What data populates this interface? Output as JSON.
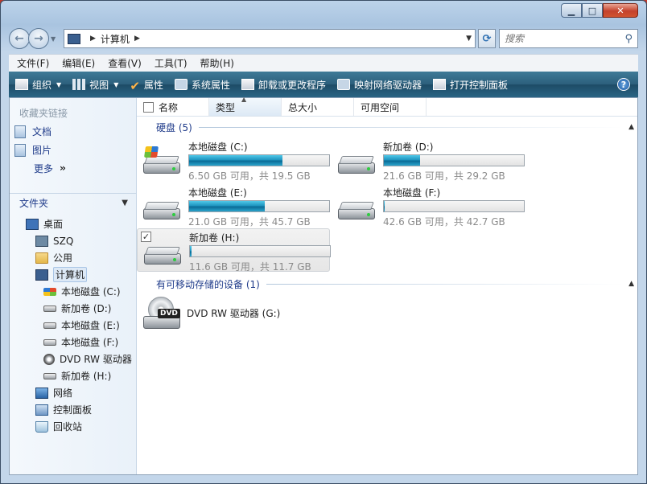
{
  "window": {
    "caption_buttons": {
      "minimize": "▁",
      "maximize": "□",
      "close": "✕"
    }
  },
  "navbar": {
    "back_icon": "back-arrow",
    "forward_icon": "forward-arrow",
    "address_path": "计算机",
    "search_placeholder": "搜索"
  },
  "menubar": {
    "items": [
      "文件(F)",
      "编辑(E)",
      "查看(V)",
      "工具(T)",
      "帮助(H)"
    ]
  },
  "toolbar": {
    "organize": "组织",
    "views": "视图",
    "properties": "属性",
    "system_properties": "系统属性",
    "uninstall": "卸载或更改程序",
    "map_drive": "映射网络驱动器",
    "control_panel": "打开控制面板",
    "help": "?"
  },
  "sidebar": {
    "favorites_title": "收藏夹链接",
    "favorites": [
      "文档",
      "图片"
    ],
    "more": "更多",
    "folders_title": "文件夹",
    "tree": [
      {
        "label": "桌面",
        "icon": "desktop",
        "level": 0
      },
      {
        "label": "SZQ",
        "icon": "user",
        "level": 1
      },
      {
        "label": "公用",
        "icon": "folder",
        "level": 1
      },
      {
        "label": "计算机",
        "icon": "computer",
        "level": 1,
        "selected": true
      },
      {
        "label": "本地磁盘 (C:)",
        "icon": "win-drive",
        "level": 2
      },
      {
        "label": "新加卷 (D:)",
        "icon": "drive",
        "level": 2
      },
      {
        "label": "本地磁盘 (E:)",
        "icon": "drive",
        "level": 2
      },
      {
        "label": "本地磁盘 (F:)",
        "icon": "drive",
        "level": 2
      },
      {
        "label": "DVD RW 驱动器",
        "icon": "dvd",
        "level": 2
      },
      {
        "label": "新加卷 (H:)",
        "icon": "drive",
        "level": 2
      },
      {
        "label": "网络",
        "icon": "network",
        "level": 1
      },
      {
        "label": "控制面板",
        "icon": "cpanel",
        "level": 1
      },
      {
        "label": "回收站",
        "icon": "recycle",
        "level": 1
      }
    ]
  },
  "columns": {
    "name": "名称",
    "type": "类型",
    "total": "总大小",
    "free": "可用空间"
  },
  "groups": {
    "hdd": "硬盘 (5)",
    "removable": "有可移动存储的设备 (1)"
  },
  "drives": [
    {
      "name": "本地磁盘 (C:)",
      "free_text": "6.50 GB 可用，共 19.5 GB",
      "used_fraction": 0.667,
      "system": true
    },
    {
      "name": "新加卷 (D:)",
      "free_text": "21.6 GB 可用，共 29.2 GB",
      "used_fraction": 0.26
    },
    {
      "name": "本地磁盘 (E:)",
      "free_text": "21.0 GB 可用，共 45.7 GB",
      "used_fraction": 0.54
    },
    {
      "name": "本地磁盘 (F:)",
      "free_text": "42.6 GB 可用，共 42.7 GB",
      "used_fraction": 0.002
    },
    {
      "name": "新加卷 (H:)",
      "free_text": "11.6 GB 可用，共 11.7 GB",
      "used_fraction": 0.01,
      "selected": true,
      "checked": "✓"
    }
  ],
  "dvd": {
    "name": "DVD RW 驱动器 (G:)",
    "badge": "DVD"
  },
  "colors": {
    "toolbar_bg": "#2c5f7c",
    "link_blue": "#1f3b8a",
    "bar_fill": "#1f95bf"
  }
}
